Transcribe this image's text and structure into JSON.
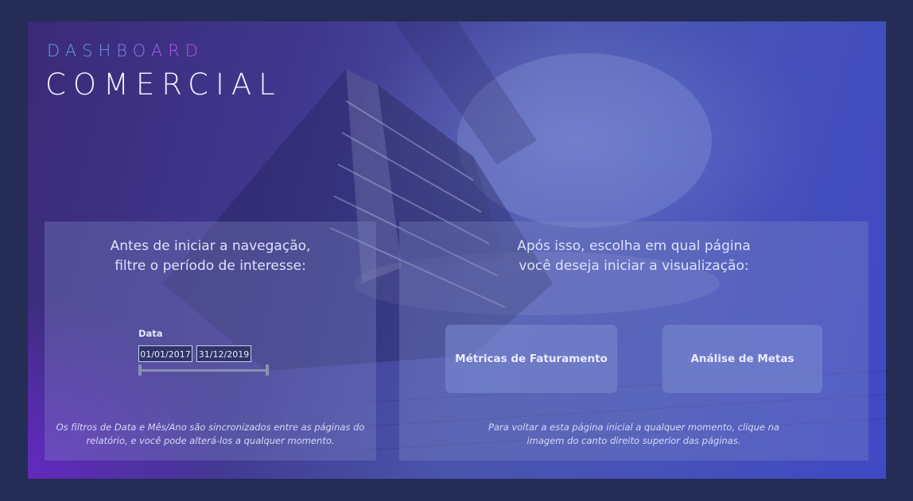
{
  "header": {
    "title_top": "DASHBOARD",
    "title_main": "COMERCIAL"
  },
  "left_panel": {
    "heading": "Antes de iniciar a navegação,\nfiltre o período de interesse:",
    "slicer": {
      "label": "Data",
      "start": "01/01/2017",
      "end": "31/12/2019"
    },
    "note": "Os filtros de Data e Mês/Ano são sincronizados entre as páginas do\nrelatório, e você pode alterá-los a qualquer momento."
  },
  "right_panel": {
    "heading": "Após isso, escolha em qual página\nvocê deseja iniciar a visualização:",
    "buttons": [
      {
        "label": "Métricas de Faturamento"
      },
      {
        "label": "Análise de Metas"
      }
    ],
    "note": "Para voltar a esta página inicial a qualquer momento, clique na\nimagem do canto direito superior das páginas."
  },
  "colors": {
    "page_bg": "#252c55",
    "title_gradient_start": "#4fb2f0",
    "title_gradient_end": "#c148e6"
  }
}
